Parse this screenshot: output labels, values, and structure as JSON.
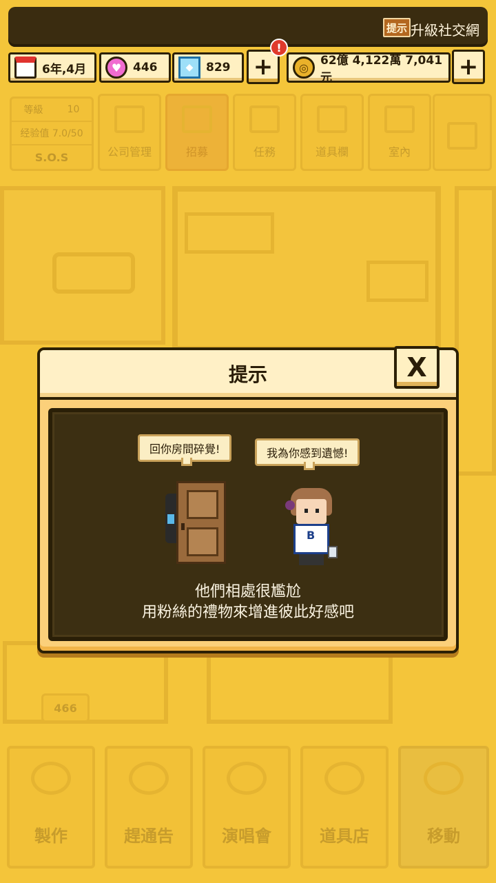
{
  "ticker": {
    "hint_label": "提示",
    "text": "升級社交網"
  },
  "resources": {
    "date": "6年,4月",
    "fans": "446",
    "gems": "829",
    "money": "62億 4,122萬 7,041元",
    "plus": "+",
    "alert": "!"
  },
  "menu": {
    "stats": {
      "level_label": "等級",
      "level_value": "10",
      "exp": "经验值 7.0/50",
      "sos": "S.O.S"
    },
    "tiles": [
      "公司管理",
      "招募",
      "任務",
      "道具欄",
      "室內",
      ""
    ]
  },
  "count_badge": "466",
  "bottom_tabs": [
    "製作",
    "趕通告",
    "演唱會",
    "道具店",
    "移動"
  ],
  "dialog": {
    "title": "提示",
    "close": "X",
    "bubble_left": "回你房間碎覺!",
    "bubble_right": "我為你感到遺憾!",
    "message_line1": "他們相處很尷尬",
    "message_line2": "用粉絲的禮物來增進彼此好感吧"
  },
  "colors": {
    "background": "#f4c53a",
    "dialog_panel": "#3c2f12",
    "accent_red": "#e03a2c"
  }
}
